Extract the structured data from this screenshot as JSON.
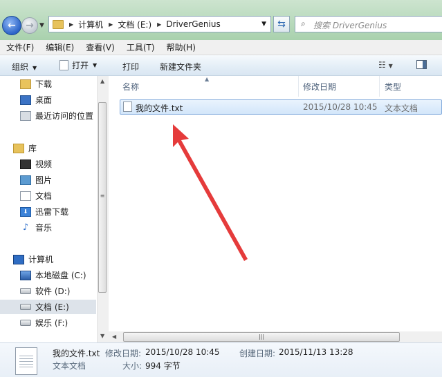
{
  "address": {
    "breadcrumbs": [
      "计算机",
      "文档 (E:)",
      "DriverGenius"
    ]
  },
  "search": {
    "placeholder": "搜索 DriverGenius"
  },
  "menu": [
    "文件(F)",
    "编辑(E)",
    "查看(V)",
    "工具(T)",
    "帮助(H)"
  ],
  "toolbar": {
    "organize": "组织",
    "open": "打开",
    "print": "打印",
    "new_folder": "新建文件夹"
  },
  "nav": {
    "favorites": [
      "下载",
      "桌面",
      "最近访问的位置"
    ],
    "library_header": "库",
    "libraries": [
      "视频",
      "图片",
      "文档",
      "迅雷下载",
      "音乐"
    ],
    "computer_header": "计算机",
    "drives": [
      "本地磁盘 (C:)",
      "软件 (D:)",
      "文档 (E:)",
      "娱乐 (F:)"
    ],
    "selected_drive": "文档 (E:)"
  },
  "columns": [
    "名称",
    "修改日期",
    "类型"
  ],
  "files": [
    {
      "name": "我的文件.txt",
      "modified": "2015/10/28 10:45",
      "type": "文本文档"
    }
  ],
  "details": {
    "name": "我的文件.txt",
    "type": "文本文档",
    "modified_label": "修改日期:",
    "modified_value": "2015/10/28 10:45",
    "created_label": "创建日期:",
    "created_value": "2015/11/13 13:28",
    "size_label": "大小:",
    "size_value": "994 字节"
  },
  "colors": {
    "annotation_arrow": "#e53b3b",
    "selection_border": "#84acdd"
  }
}
